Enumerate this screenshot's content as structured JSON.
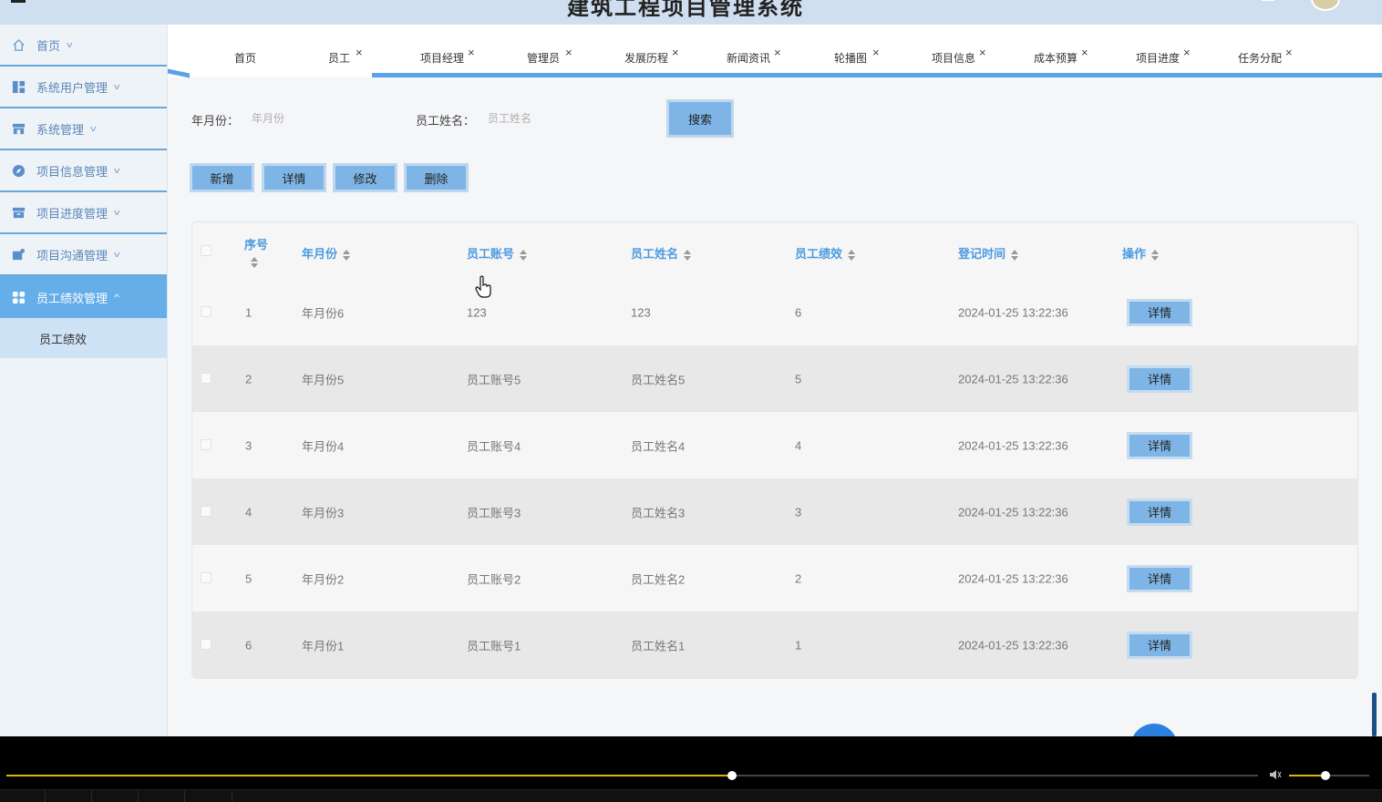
{
  "app": {
    "title": "建筑工程项目管理系统"
  },
  "sidebar": {
    "items": [
      {
        "label": "首页",
        "icon": "home-icon"
      },
      {
        "label": "系统用户管理",
        "icon": "dashboard-icon"
      },
      {
        "label": "系统管理",
        "icon": "store-icon"
      },
      {
        "label": "项目信息管理",
        "icon": "compass-icon"
      },
      {
        "label": "项目进度管理",
        "icon": "archive-icon"
      },
      {
        "label": "项目沟通管理",
        "icon": "chat-icon"
      },
      {
        "label": "员工绩效管理",
        "icon": "grid-icon",
        "active": true
      }
    ],
    "submenu": [
      {
        "label": "员工绩效"
      }
    ]
  },
  "tabs": [
    {
      "label": "首页",
      "closable": false
    },
    {
      "label": "员工",
      "closable": true
    },
    {
      "label": "项目经理",
      "closable": true
    },
    {
      "label": "管理员",
      "closable": true
    },
    {
      "label": "发展历程",
      "closable": true
    },
    {
      "label": "新闻资讯",
      "closable": true
    },
    {
      "label": "轮播图",
      "closable": true
    },
    {
      "label": "项目信息",
      "closable": true
    },
    {
      "label": "成本预算",
      "closable": true
    },
    {
      "label": "项目进度",
      "closable": true
    },
    {
      "label": "任务分配",
      "closable": true
    }
  ],
  "tab_close_glyph": "×",
  "search": {
    "month_label": "年月份：",
    "month_placeholder": "年月份",
    "name_label": "员工姓名：",
    "name_placeholder": "员工姓名",
    "search_button": "搜索"
  },
  "toolbar": {
    "add": "新增",
    "detail": "详情",
    "edit": "修改",
    "delete": "删除"
  },
  "table": {
    "columns": [
      "序号",
      "年月份",
      "员工账号",
      "员工姓名",
      "员工绩效",
      "登记时间",
      "操作"
    ],
    "rows": [
      {
        "index": "1",
        "month": "年月份6",
        "account": "123",
        "name": "123",
        "score": "6",
        "time": "2024-01-25 13:22:36",
        "action": "详情"
      },
      {
        "index": "2",
        "month": "年月份5",
        "account": "员工账号5",
        "name": "员工姓名5",
        "score": "5",
        "time": "2024-01-25 13:22:36",
        "action": "详情"
      },
      {
        "index": "3",
        "month": "年月份4",
        "account": "员工账号4",
        "name": "员工姓名4",
        "score": "4",
        "time": "2024-01-25 13:22:36",
        "action": "详情"
      },
      {
        "index": "4",
        "month": "年月份3",
        "account": "员工账号3",
        "name": "员工姓名3",
        "score": "3",
        "time": "2024-01-25 13:22:36",
        "action": "详情"
      },
      {
        "index": "5",
        "month": "年月份2",
        "account": "员工账号2",
        "name": "员工姓名2",
        "score": "2",
        "time": "2024-01-25 13:22:36",
        "action": "详情"
      },
      {
        "index": "6",
        "month": "年月份1",
        "account": "员工账号1",
        "name": "员工姓名1",
        "score": "1",
        "time": "2024-01-25 13:22:36",
        "action": "详情"
      }
    ]
  },
  "player": {
    "progress": 0.58,
    "volume": 0.45
  },
  "colors": {
    "accent": "#5aa3e6",
    "button": "#7eb5e6",
    "header_text": "#4d9be0",
    "progress": "#e0b400"
  }
}
